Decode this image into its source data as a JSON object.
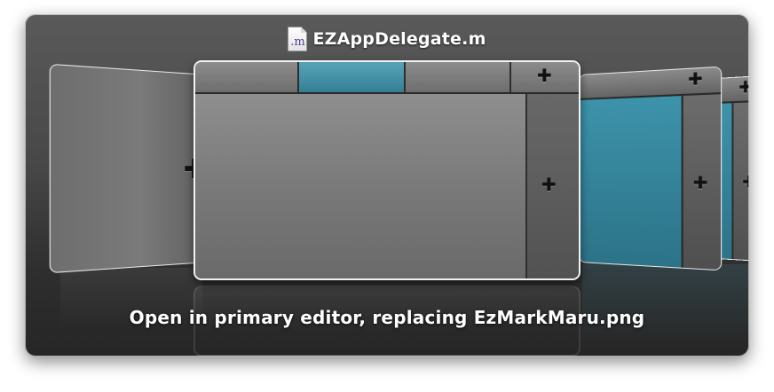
{
  "header": {
    "file_icon_label": ".m",
    "file_name": "EZAppDelegate.m"
  },
  "cards": {
    "plus_glyph": "✚"
  },
  "action_text": "Open in primary editor, replacing EzMarkMaru.png",
  "colors": {
    "accent_teal": "#3d93aa",
    "panel_dark": "#2e2e2e",
    "title_text": "#ffffff"
  }
}
